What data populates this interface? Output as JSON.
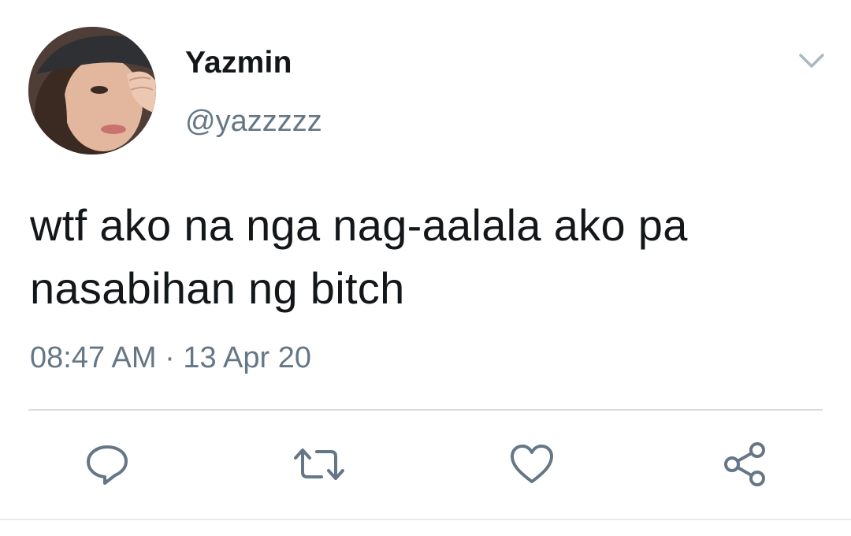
{
  "user": {
    "display_name": "Yazmin",
    "handle": "@yazzzzz",
    "avatar_icon": "profile-photo"
  },
  "tweet": {
    "text": "wtf ako na nga nag-aalala ako pa nasabihan ng bitch",
    "timestamp": "08:47 AM · 13 Apr 20"
  },
  "actions": {
    "reply_icon": "speech-bubble-icon",
    "retweet_icon": "retweet-arrows-icon",
    "like_icon": "heart-icon",
    "share_icon": "share-nodes-icon"
  },
  "colors": {
    "text": "#14171a",
    "secondary": "#657786",
    "icon": "#657786",
    "divider": "#d8dde2"
  }
}
